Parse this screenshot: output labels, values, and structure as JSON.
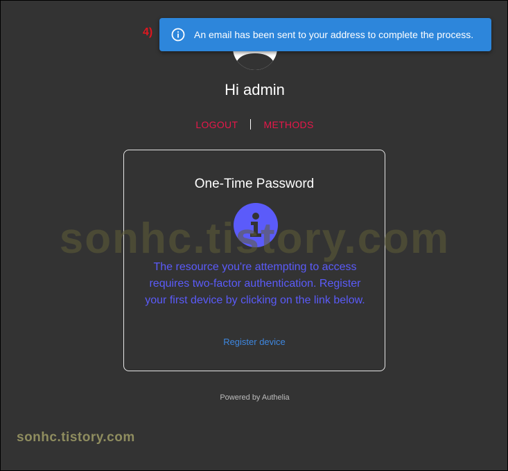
{
  "toast": {
    "icon": "info-circle-icon",
    "message": "An email has been sent to your address to complete the process.",
    "color": "#2d86db"
  },
  "annotation": {
    "step": "4)"
  },
  "user": {
    "avatar_icon": "user-avatar-icon",
    "greeting": "Hi admin"
  },
  "nav": {
    "logout": "LOGOUT",
    "methods": "METHODS",
    "accent_color": "#e8174a"
  },
  "card": {
    "title": "One-Time Password",
    "icon": "info-icon",
    "icon_color": "#5b5bfa",
    "message": "The resource you're attempting to access requires two-factor authentication. Register your first device by clicking on the link below.",
    "register_link": "Register device"
  },
  "footer": {
    "powered_by": "Powered by Authelia"
  },
  "watermarks": {
    "large": "sonhc.tistory.com",
    "small": "sonhc.tistory.com"
  }
}
